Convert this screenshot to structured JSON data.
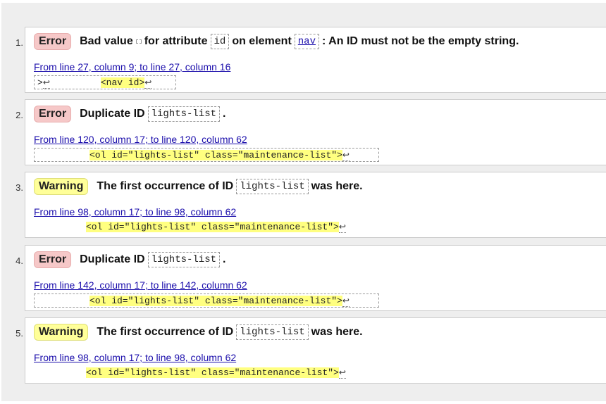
{
  "messages": [
    {
      "num": "1.",
      "type": "Error",
      "text_a": "Bad value",
      "code1": "",
      "text_b": "for attribute",
      "code2": "id",
      "text_c": "on element",
      "code3": "nav",
      "text_d": ": An ID must not be the empty string.",
      "location": "From line 27, column 9; to line 27, column 16",
      "extract_pre": ">",
      "extract_pre_ret": "↩",
      "extract_hl": "<nav id>",
      "extract_ret": "↩"
    },
    {
      "num": "2.",
      "type": "Error",
      "text_a": "Duplicate ID",
      "code1": "lights-list",
      "text_b": ".",
      "location": "From line 120, column 17; to line 120, column 62",
      "extract_hl": "<ol id=\"lights-list\" class=\"maintenance-list\">",
      "extract_ret": "↩"
    },
    {
      "num": "3.",
      "type": "Warning",
      "text_a": "The first occurrence of ID",
      "code1": "lights-list",
      "text_b": "was here.",
      "location": "From line 98, column 17; to line 98, column 62",
      "extract_hl": "<ol id=\"lights-list\" class=\"maintenance-list\">",
      "extract_ret": "↩"
    },
    {
      "num": "4.",
      "type": "Error",
      "text_a": "Duplicate ID",
      "code1": "lights-list",
      "text_b": ".",
      "location": "From line 142, column 17; to line 142, column 62",
      "extract_hl": "<ol id=\"lights-list\" class=\"maintenance-list\">",
      "extract_ret": "↩"
    },
    {
      "num": "5.",
      "type": "Warning",
      "text_a": "The first occurrence of ID",
      "code1": "lights-list",
      "text_b": "was here.",
      "location": "From line 98, column 17; to line 98, column 62",
      "extract_hl": "<ol id=\"lights-list\" class=\"maintenance-list\">",
      "extract_ret": "↩"
    }
  ],
  "colors": {
    "error_badge": "#f6c8c8",
    "warning_badge": "#ffff99",
    "highlight": "#ffff80",
    "link": "#1a0dab"
  }
}
